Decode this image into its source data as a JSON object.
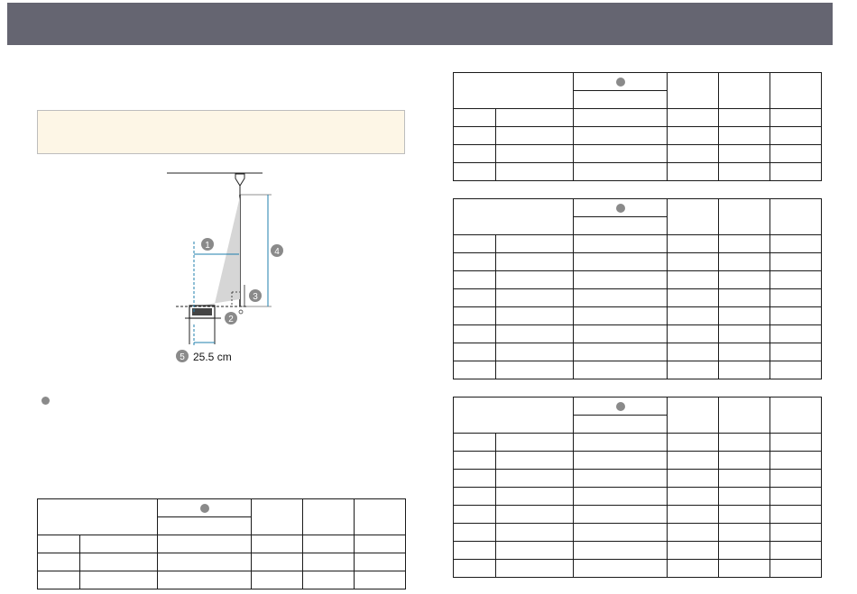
{
  "header": {
    "color": "#656571"
  },
  "note_box": {
    "background": "#fdf6e6"
  },
  "diagram": {
    "labels": [
      "1",
      "2",
      "3",
      "4",
      "5"
    ],
    "dimension_text": "25.5 cm",
    "accent_color": "#1f7fae"
  },
  "legend": {
    "marker_icon": "numbered-circle-1-icon"
  },
  "tables": {
    "bottom_left": {
      "rows": 3
    },
    "right_top": {
      "rows": 4
    },
    "right_middle": {
      "rows": 8
    },
    "right_bottom": {
      "rows": 8
    }
  }
}
